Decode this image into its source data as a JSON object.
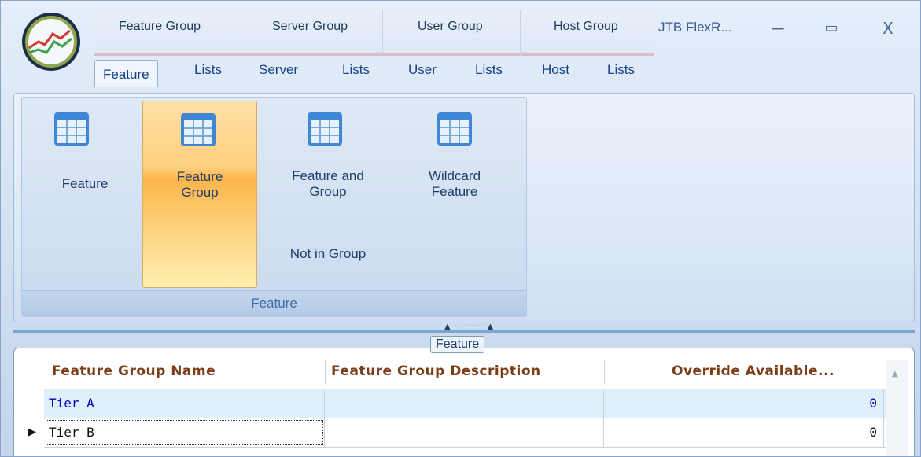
{
  "app": {
    "title": "JTB FlexR...",
    "colors": {
      "accent": "#fbb54a",
      "header_text": "#7a3d16",
      "link_text": "#0000c0"
    }
  },
  "context_groups": [
    {
      "label": "Feature Group"
    },
    {
      "label": "Server Group"
    },
    {
      "label": "User Group"
    },
    {
      "label": "Host Group"
    }
  ],
  "window_controls": {
    "minimize": "−",
    "maximize": "▭",
    "close": "X"
  },
  "tabs": [
    "Feature",
    "Lists",
    "Server",
    "Lists",
    "User",
    "Lists",
    "Host",
    "Lists"
  ],
  "ribbon": {
    "group_label": "Feature",
    "buttons": [
      {
        "label": "Feature",
        "icon": "grid-icon"
      },
      {
        "label_line1": "Feature",
        "label_line2": "Group",
        "icon": "grid-icon",
        "selected": true
      },
      {
        "label_line1": "Feature and",
        "label_line2": "Group",
        "label_extra": "Not in Group",
        "icon": "grid-icon"
      },
      {
        "label_line1": "Wildcard",
        "label_line2": "Feature",
        "icon": "grid-icon"
      }
    ]
  },
  "panel": {
    "title": "Feature"
  },
  "grid": {
    "columns": [
      "Feature Group Name",
      "Feature Group Description",
      "Override Available..."
    ],
    "rows": [
      {
        "name": "Tier A",
        "description": "",
        "override": "0"
      },
      {
        "name": "Tier B",
        "description": "",
        "override": "0"
      }
    ]
  }
}
